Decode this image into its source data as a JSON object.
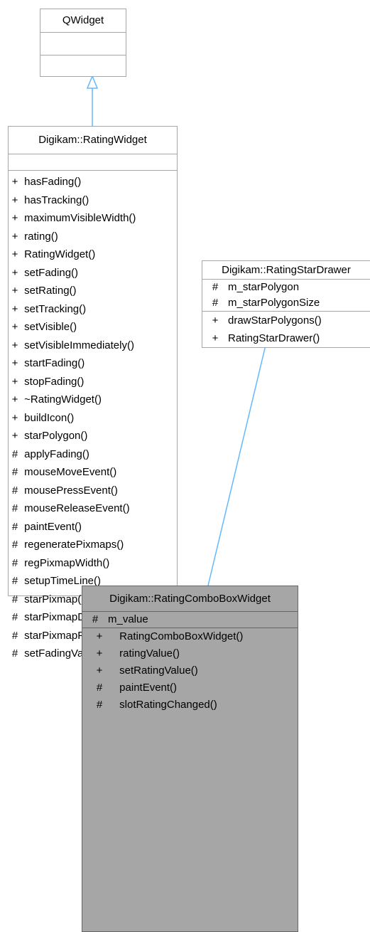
{
  "diagram": {
    "qwidget": {
      "name": "QWidget"
    },
    "rating_widget": {
      "name": "Digikam::RatingWidget",
      "members": [
        {
          "vis": "+",
          "name": "hasFading()"
        },
        {
          "vis": "+",
          "name": "hasTracking()"
        },
        {
          "vis": "+",
          "name": "maximumVisibleWidth()"
        },
        {
          "vis": "+",
          "name": "rating()"
        },
        {
          "vis": "+",
          "name": "RatingWidget()"
        },
        {
          "vis": "+",
          "name": "setFading()"
        },
        {
          "vis": "+",
          "name": "setRating()"
        },
        {
          "vis": "+",
          "name": "setTracking()"
        },
        {
          "vis": "+",
          "name": "setVisible()"
        },
        {
          "vis": "+",
          "name": "setVisibleImmediately()"
        },
        {
          "vis": "+",
          "name": "startFading()"
        },
        {
          "vis": "+",
          "name": "stopFading()"
        },
        {
          "vis": "+",
          "name": "~RatingWidget()"
        },
        {
          "vis": "+",
          "name": "buildIcon()"
        },
        {
          "vis": "+",
          "name": "starPolygon()"
        },
        {
          "vis": "#",
          "name": "applyFading()"
        },
        {
          "vis": "#",
          "name": "mouseMoveEvent()"
        },
        {
          "vis": "#",
          "name": "mousePressEvent()"
        },
        {
          "vis": "#",
          "name": "mouseReleaseEvent()"
        },
        {
          "vis": "#",
          "name": "paintEvent()"
        },
        {
          "vis": "#",
          "name": "regeneratePixmaps()"
        },
        {
          "vis": "#",
          "name": "regPixmapWidth()"
        },
        {
          "vis": "#",
          "name": "setupTimeLine()"
        },
        {
          "vis": "#",
          "name": "starPixmap()"
        },
        {
          "vis": "#",
          "name": "starPixmapDisabled()"
        },
        {
          "vis": "#",
          "name": "starPixmapFilled()"
        },
        {
          "vis": "#",
          "name": "setFadingValue()"
        }
      ]
    },
    "star_drawer": {
      "name": "Digikam::RatingStarDrawer",
      "attributes": [
        {
          "vis": "#",
          "name": "m_starPolygon"
        },
        {
          "vis": "#",
          "name": "m_starPolygonSize"
        }
      ],
      "methods": [
        {
          "vis": "+",
          "name": "drawStarPolygons()"
        },
        {
          "vis": "+",
          "name": "RatingStarDrawer()"
        }
      ]
    },
    "combo_widget": {
      "name": "Digikam::RatingComboBoxWidget",
      "attributes": [
        {
          "vis": "#",
          "name": "m_value"
        }
      ],
      "methods": [
        {
          "vis": "+",
          "name": "RatingComboBoxWidget()"
        },
        {
          "vis": "+",
          "name": "ratingValue()"
        },
        {
          "vis": "+",
          "name": "setRatingValue()"
        },
        {
          "vis": "#",
          "name": "paintEvent()"
        },
        {
          "vis": "#",
          "name": "slotRatingChanged()"
        }
      ]
    },
    "colors": {
      "edge": "#63b8ff",
      "border": "#a6a6a6",
      "highlight_fill": "#a6a6a6",
      "highlight_border": "#666666"
    }
  }
}
